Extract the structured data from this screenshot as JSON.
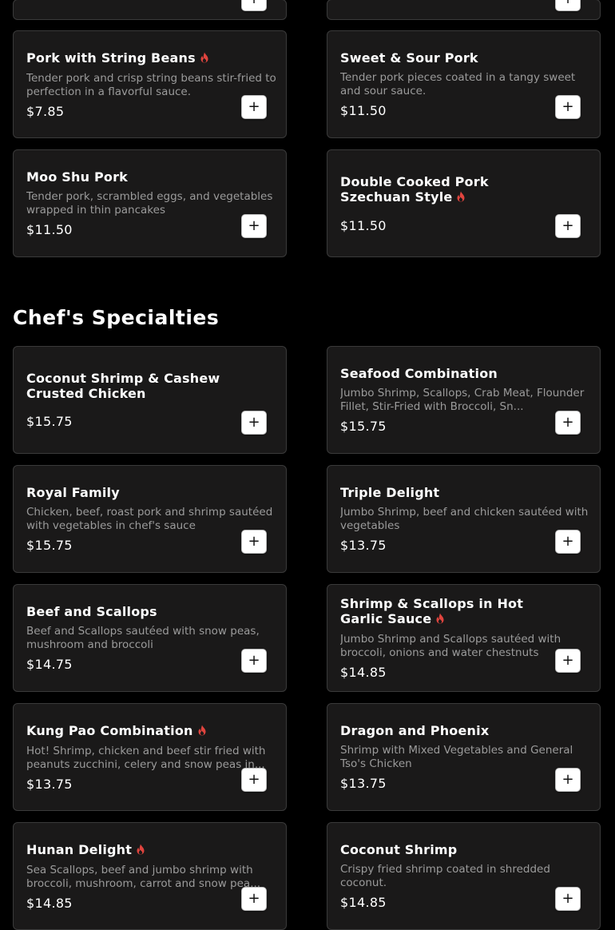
{
  "sections": {
    "specialties_title": "Chef's Specialties"
  },
  "add_label": "+",
  "colors": {
    "card_bg": "#1a1919",
    "spicy": "#e0443e",
    "desc": "#9b9b9b"
  },
  "pork_items": [
    {
      "name": "Pork with String Beans",
      "spicy": true,
      "desc": "Tender pork and crisp string beans stir-fried to perfection in a flavorful sauce.",
      "price": "$7.85"
    },
    {
      "name": "Sweet & Sour Pork",
      "spicy": false,
      "desc": "Tender pork pieces coated in a tangy sweet and sour sauce.",
      "price": "$11.50"
    },
    {
      "name": "Moo Shu Pork",
      "spicy": false,
      "desc": "Tender pork, scrambled eggs, and vegetables wrapped in thin pancakes",
      "price": "$11.50"
    },
    {
      "name": "Double Cooked Pork Szechuan Style",
      "spicy": true,
      "desc": "",
      "price": "$11.50"
    }
  ],
  "specialty_items": [
    {
      "name": "Coconut Shrimp & Cashew Crusted Chicken",
      "spicy": false,
      "desc": "",
      "price": "$15.75"
    },
    {
      "name": "Seafood Combination",
      "spicy": false,
      "desc": "Jumbo Shrimp, Scallops, Crab Meat, Flounder Fillet, Stir-Fried with Broccoli, Sn...",
      "price": "$15.75"
    },
    {
      "name": "Royal Family",
      "spicy": false,
      "desc": "Chicken, beef, roast pork and shrimp sautéed with vegetables in chef's sauce",
      "price": "$15.75"
    },
    {
      "name": "Triple Delight",
      "spicy": false,
      "desc": "Jumbo Shrimp, beef and chicken sautéed with vegetables",
      "price": "$13.75"
    },
    {
      "name": "Beef and Scallops",
      "spicy": false,
      "desc": "Beef and Scallops sautéed with snow peas, mushroom and broccoli",
      "price": "$14.75"
    },
    {
      "name": "Shrimp & Scallops in Hot Garlic Sauce",
      "spicy": true,
      "desc": "Jumbo Shrimp and Scallops sautéed with broccoli, onions and water chestnuts",
      "price": "$14.85"
    },
    {
      "name": "Kung Pao Combination",
      "spicy": true,
      "desc": "Hot! Shrimp, chicken and beef stir fried with peanuts zucchini, celery and snow peas in...",
      "price": "$13.75"
    },
    {
      "name": "Dragon and Phoenix",
      "spicy": false,
      "desc": "Shrimp with Mixed Vegetables and General Tso's Chicken",
      "price": "$13.75"
    },
    {
      "name": "Hunan Delight",
      "spicy": true,
      "desc": "Sea Scallops, beef and jumbo shrimp with broccoli, mushroom, carrot and snow pea...",
      "price": "$14.85"
    },
    {
      "name": "Coconut Shrimp",
      "spicy": false,
      "desc": "Crispy fried shrimp coated in shredded coconut.",
      "price": "$14.85"
    }
  ]
}
